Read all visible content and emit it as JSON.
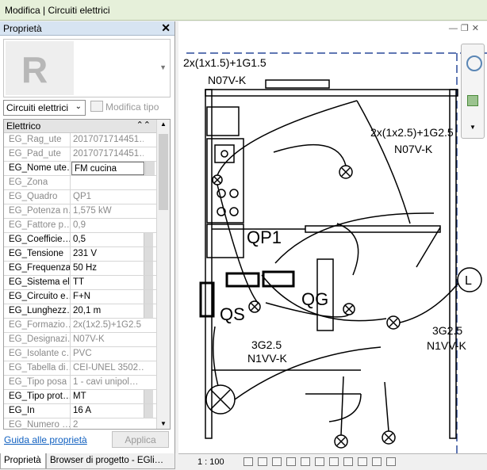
{
  "window": {
    "title": "Modifica | Circuiti elettrici"
  },
  "properties": {
    "panel_title": "Proprietà",
    "close_glyph": "✕",
    "category": "Circuiti elettrici",
    "edit_type_label": "Modifica tipo",
    "group_label": "Elettrico",
    "rows": [
      {
        "key": "EG_Rag_ute",
        "value": "2017071714451…",
        "greyed": true
      },
      {
        "key": "EG_Pad_ute",
        "value": "2017071714451…",
        "greyed": true
      },
      {
        "key": "EG_Nome ute…",
        "value": "FM cucina",
        "greyed": false,
        "editing": true
      },
      {
        "key": "EG_Zona",
        "value": "",
        "greyed": true
      },
      {
        "key": "EG_Quadro",
        "value": "QP1",
        "greyed": true
      },
      {
        "key": "EG_Potenza n…",
        "value": "1,575 kW",
        "greyed": true
      },
      {
        "key": "EG_Fattore p…",
        "value": "0,9",
        "greyed": true
      },
      {
        "key": "EG_Coefficie…",
        "value": "0,5",
        "greyed": false
      },
      {
        "key": "EG_Tensione",
        "value": "231 V",
        "greyed": false
      },
      {
        "key": "EG_Frequenza",
        "value": "50 Hz",
        "greyed": false
      },
      {
        "key": "EG_Sistema el…",
        "value": "TT",
        "greyed": false
      },
      {
        "key": "EG_Circuito e…",
        "value": "F+N",
        "greyed": false
      },
      {
        "key": "EG_Lunghezz…",
        "value": "20,1 m",
        "greyed": false
      },
      {
        "key": "EG_Formazio…",
        "value": "2x(1x2.5)+1G2.5",
        "greyed": true
      },
      {
        "key": "EG_Designazi…",
        "value": "N07V-K",
        "greyed": true
      },
      {
        "key": "EG_Isolante c…",
        "value": "PVC",
        "greyed": true
      },
      {
        "key": "EG_Tabella di…",
        "value": "CEI-UNEL 3502…",
        "greyed": true
      },
      {
        "key": "EG_Tipo posa",
        "value": "1 - cavi unipol…",
        "greyed": true
      },
      {
        "key": "EG_Tipo prot…",
        "value": "MT",
        "greyed": false
      },
      {
        "key": "EG_In",
        "value": "16 A",
        "greyed": false
      },
      {
        "key": "EG_Numero …",
        "value": "2",
        "greyed": true
      }
    ],
    "help_link": "Guida alle proprietà",
    "apply_label": "Applica"
  },
  "bottom_tabs": [
    {
      "label": "Proprietà",
      "active": true
    },
    {
      "label": "Browser di progetto - EGli…",
      "active": false
    }
  ],
  "drawing": {
    "labels": {
      "cable_top_1": "2x(1x1.5)+1G1.5",
      "cable_top_2": "N07V-K",
      "cable_right_1": "2x(1x2.5)+1G2.5",
      "cable_right_2": "N07V-K",
      "panel_qp1": "QP1",
      "panel_qg": "QG",
      "panel_qs": "QS",
      "light": "L",
      "cable_mid_1": "3G2.5",
      "cable_mid_2": "N1VV-K",
      "cable_r2_1": "3G2.5",
      "cable_r2_2": "N1VV-K"
    }
  },
  "statusbar": {
    "scale": "1 : 100"
  },
  "view_controls": {
    "minimize": "—",
    "restore": "❐",
    "close": "✕"
  }
}
